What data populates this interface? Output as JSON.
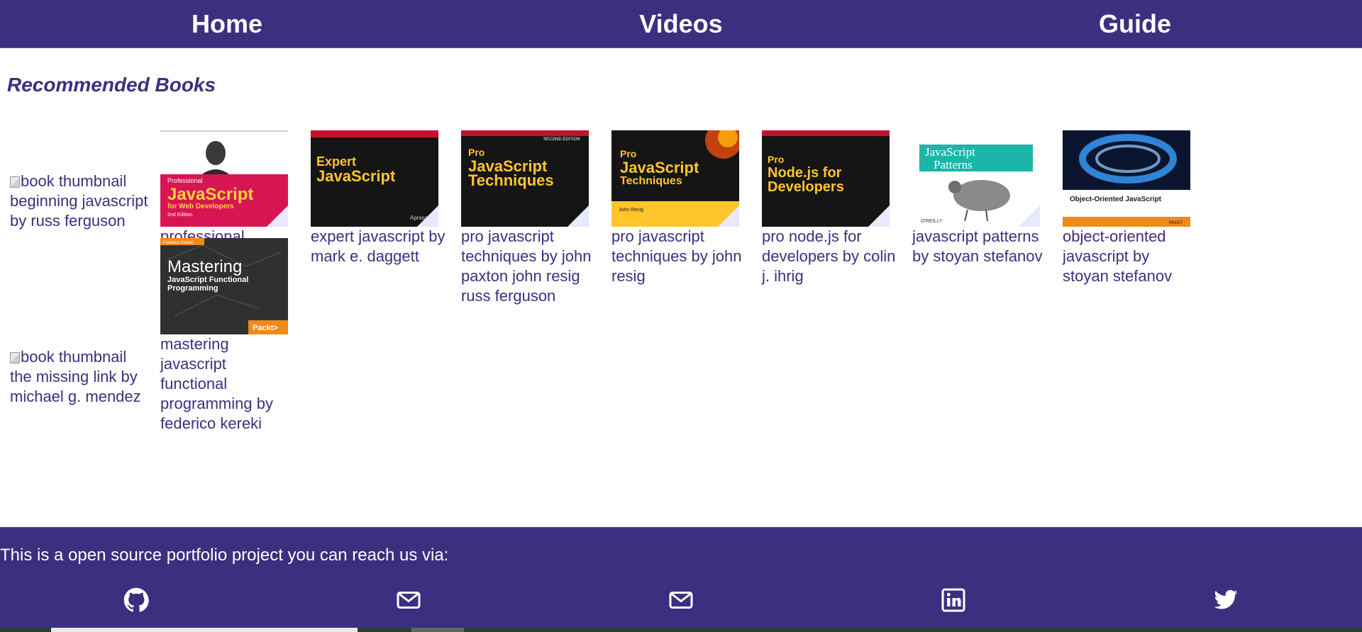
{
  "nav": {
    "items": [
      {
        "label": "Home"
      },
      {
        "label": "Videos"
      },
      {
        "label": "Guide"
      }
    ]
  },
  "section_title": "Recommended Books",
  "books": [
    {
      "title": "beginning javascript by russ ferguson",
      "alt": "book thumbnail",
      "cover": "broken"
    },
    {
      "title": "professional javascript for web developers by nicholas c. zakas",
      "cover": "professional-js"
    },
    {
      "title": "expert javascript by mark e. daggett",
      "cover": "expert-js"
    },
    {
      "title": "pro javascript techniques by john paxton john resig russ ferguson",
      "cover": "pro-js-2e"
    },
    {
      "title": "pro javascript techniques by john resig",
      "cover": "pro-js"
    },
    {
      "title": "pro node.js for developers by colin j. ihrig",
      "cover": "pro-node"
    },
    {
      "title": "javascript patterns by stoyan stefanov",
      "cover": "js-patterns"
    },
    {
      "title": "object-oriented javascript by stoyan stefanov",
      "cover": "oo-js"
    },
    {
      "title": "the missing link by michael g. mendez",
      "alt": "book thumbnail",
      "cover": "broken"
    },
    {
      "title": "mastering javascript functional programming by federico kereki",
      "cover": "mastering-fp"
    }
  ],
  "cover_text": {
    "professional_js": {
      "top": "Professional",
      "main": "JavaScript",
      "sub": "for Web Developers",
      "edition": "2nd Edition"
    },
    "expert_js": {
      "main1": "Expert",
      "main2": "JavaScript",
      "publisher": "Apress"
    },
    "pro_js_2e": {
      "edition": "SECOND EDITION",
      "main1": "Pro",
      "main2": "JavaScript",
      "main3": "Techniques"
    },
    "pro_js": {
      "main1": "Pro",
      "main2": "JavaScript",
      "main3": "Techniques",
      "author": "John Resig"
    },
    "pro_node": {
      "main1": "Pro",
      "main2": "Node.js for",
      "main3": "Developers"
    },
    "js_patterns": {
      "main1": "JavaScript",
      "main2": "Patterns",
      "publisher": "O'REILLY"
    },
    "oo_js": {
      "main": "Object-Oriented JavaScript",
      "publisher": "PACKT"
    },
    "mastering_fp": {
      "author": "Federico Kereki",
      "main1": "Mastering",
      "main2": "JavaScript Functional",
      "main3": "Programming",
      "publisher": "Packt>"
    }
  },
  "footer": {
    "text": "This is a open source portfolio project you can reach us via:",
    "icons": [
      "github-icon",
      "envelope-icon",
      "envelope-icon",
      "linkedin-icon",
      "twitter-icon"
    ]
  },
  "colors": {
    "primary": "#3c2f80",
    "white": "#ffffff"
  }
}
